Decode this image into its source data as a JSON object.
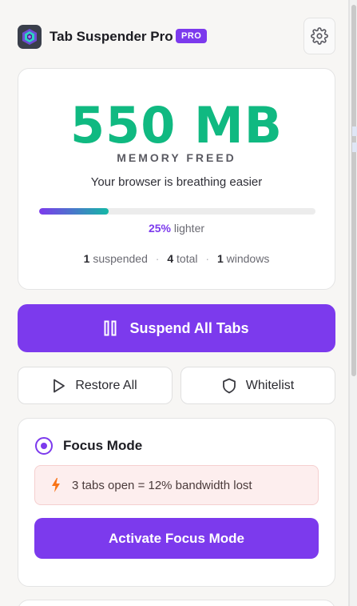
{
  "header": {
    "title": "Tab Suspender Pro",
    "badge": "PRO",
    "logo_icon": "hexagon-logo-icon",
    "settings_icon": "gear-icon"
  },
  "stats": {
    "memory": "550 MB",
    "memory_label": "MEMORY FREED",
    "tagline": "Your browser is breathing easier",
    "progress_fraction": 0.25,
    "lighter_pct": "25%",
    "lighter_text": "lighter",
    "suspended_count": "1",
    "suspended_label": "suspended",
    "total_count": "4",
    "total_label": "total",
    "windows_count": "1",
    "windows_label": "windows"
  },
  "actions": {
    "suspend_all": "Suspend All Tabs",
    "restore_all": "Restore All",
    "whitelist": "Whitelist"
  },
  "focus": {
    "title": "Focus Mode",
    "warning": "3 tabs open = 12% bandwidth lost",
    "activate": "Activate Focus Mode"
  },
  "colors": {
    "accent": "#7c3aed",
    "success": "#10b981",
    "warning_bg": "#fdeeee",
    "bolt": "#f97316"
  }
}
